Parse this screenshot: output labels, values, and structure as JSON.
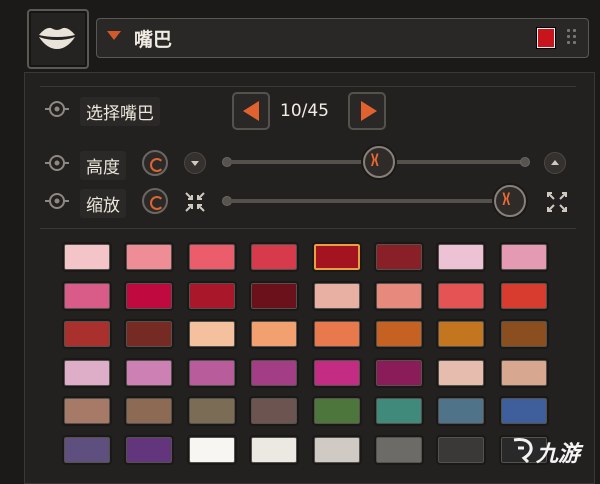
{
  "header": {
    "title": "嘴巴",
    "selected_color": "#c8141c"
  },
  "rows": {
    "select": {
      "label": "选择嘴巴",
      "counter": "10/45"
    },
    "height": {
      "label": "高度",
      "value": 0.51
    },
    "scale": {
      "label": "缩放",
      "value": 0.96
    }
  },
  "palette": {
    "selected_index": 4,
    "colors": [
      "#f3c4c8",
      "#ef8d97",
      "#ec5d6b",
      "#d73b4b",
      "#a31320",
      "#8a2027",
      "#eec2d5",
      "#e59ab3",
      "#d95c88",
      "#c0093f",
      "#a8182a",
      "#6a111c",
      "#e7b0a3",
      "#e8897d",
      "#e55355",
      "#d83c2f",
      "#a9302c",
      "#762a24",
      "#f5c09e",
      "#f3a070",
      "#e8794d",
      "#c56122",
      "#c4751f",
      "#8a4e1f",
      "#deaec8",
      "#cd80b3",
      "#b95c9c",
      "#a33d86",
      "#c32c82",
      "#8a1d59",
      "#e6bcae",
      "#d8a78f",
      "#a67a66",
      "#8d6a54",
      "#7b6c55",
      "#6c5451",
      "#4d763c",
      "#3f8a7b",
      "#4f7388",
      "#3f5f9c",
      "#5e4f7e",
      "#63357d",
      "#f7f6f3",
      "#ece8e2",
      "#cfcbc4",
      "#6d6b67",
      "#3a3937",
      "#29292a"
    ]
  },
  "watermark": {
    "text": "九游"
  },
  "icons": {
    "lips": "lips-icon",
    "dropdown": "triangle-down-icon",
    "drag": "drag-handle-icon",
    "row": "eye-toggle-icon",
    "prev": "arrow-left-icon",
    "next": "arrow-right-icon",
    "reset": "reset-icon",
    "down": "chevron-down-icon",
    "up": "chevron-up-icon",
    "shrink": "shrink-icon",
    "expand": "expand-icon"
  }
}
